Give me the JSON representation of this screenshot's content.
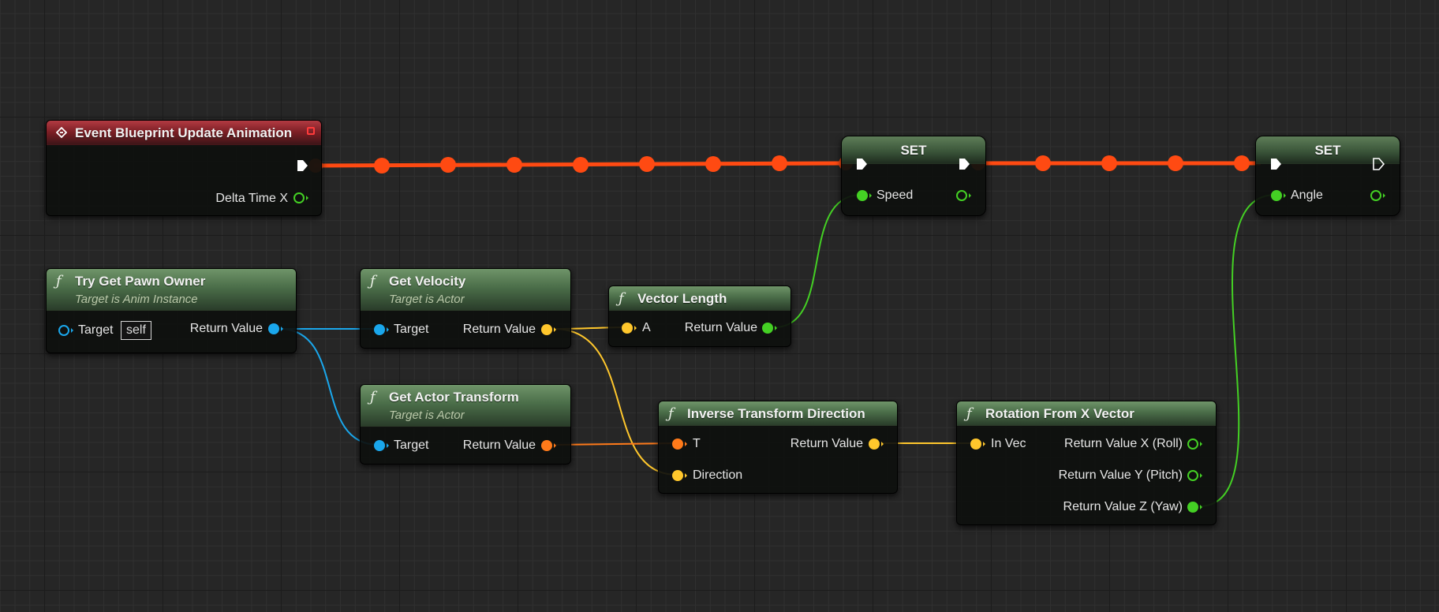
{
  "colors": {
    "exec_wire": "#ff4a12",
    "object_wire": "#1aa7ec",
    "vector_wire": "#ffc72c",
    "transform_wire": "#ff7a1a",
    "float_wire": "#44d024"
  },
  "icons": {
    "event": "event-diamond-icon",
    "function": "function-f-icon",
    "close": "close-box-icon"
  },
  "nodes": {
    "event_update": {
      "title": "Event Blueprint Update Animation",
      "output_delta": "Delta Time X"
    },
    "try_get_pawn_owner": {
      "title": "Try Get Pawn Owner",
      "subtitle": "Target is Anim Instance",
      "input_target": "Target",
      "target_default": "self",
      "output_return": "Return Value"
    },
    "get_velocity": {
      "title": "Get Velocity",
      "subtitle": "Target is Actor",
      "input_target": "Target",
      "output_return": "Return Value"
    },
    "get_actor_transform": {
      "title": "Get Actor Transform",
      "subtitle": "Target is Actor",
      "input_target": "Target",
      "output_return": "Return Value"
    },
    "vector_length": {
      "title": "Vector Length",
      "input_a": "A",
      "output_return": "Return Value"
    },
    "inverse_transform_direction": {
      "title": "Inverse Transform Direction",
      "input_t": "T",
      "input_direction": "Direction",
      "output_return": "Return Value"
    },
    "rotation_from_x_vector": {
      "title": "Rotation From X Vector",
      "input_in_vec": "In Vec",
      "output_roll": "Return Value X (Roll)",
      "output_pitch": "Return Value Y (Pitch)",
      "output_yaw": "Return Value Z (Yaw)"
    },
    "set_speed": {
      "title": "SET",
      "variable": "Speed"
    },
    "set_angle": {
      "title": "SET",
      "variable": "Angle"
    }
  }
}
